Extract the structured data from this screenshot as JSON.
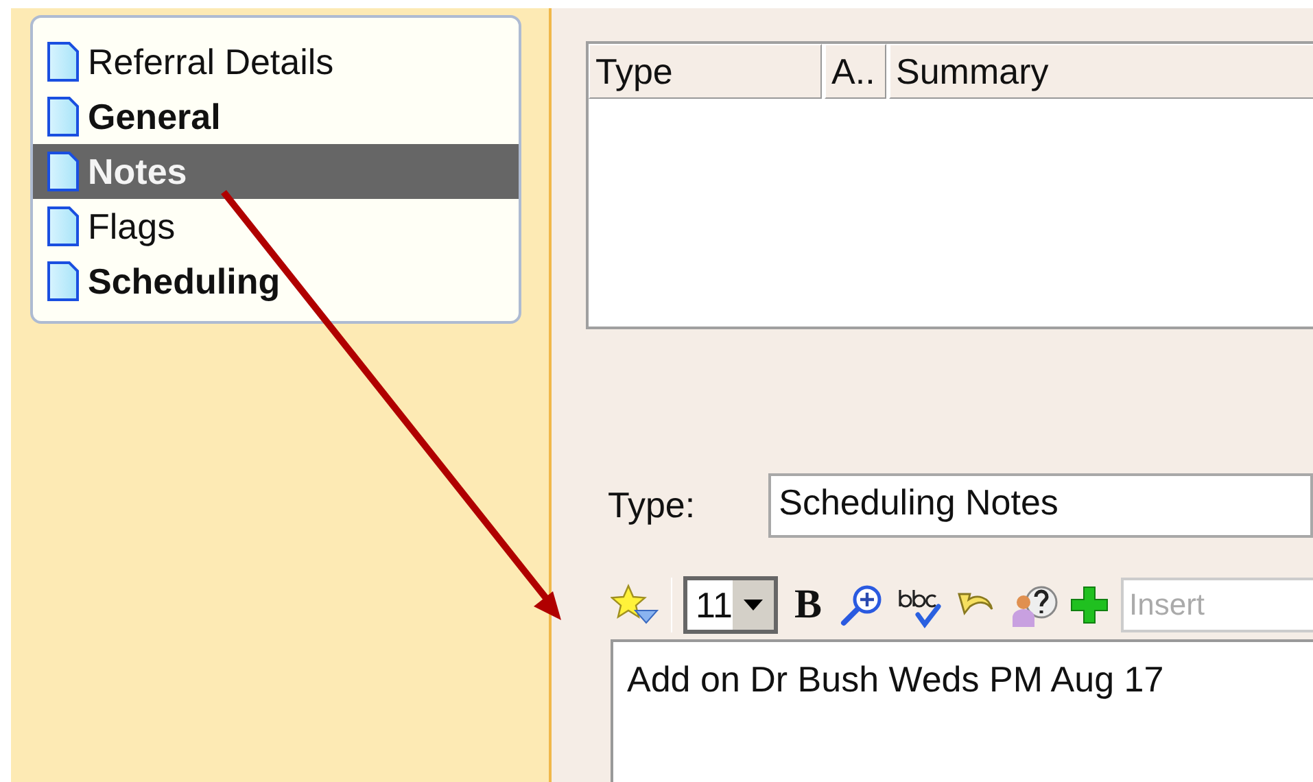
{
  "sidebar": {
    "items": [
      {
        "label": "Referral Details",
        "bold": false,
        "selected": false
      },
      {
        "label": "General",
        "bold": true,
        "selected": false
      },
      {
        "label": "Notes",
        "bold": true,
        "selected": true
      },
      {
        "label": "Flags",
        "bold": false,
        "selected": false
      },
      {
        "label": "Scheduling",
        "bold": true,
        "selected": false
      }
    ]
  },
  "notes_table": {
    "columns": [
      "Type",
      "A..",
      "Summary"
    ]
  },
  "type_field": {
    "label": "Type:",
    "value": "Scheduling Notes"
  },
  "toolbar": {
    "font_size": "11",
    "bold_button": "B",
    "insert_field": {
      "placeholder": "Insert"
    }
  },
  "editor": {
    "text": "Add on Dr Bush Weds PM Aug 17"
  }
}
